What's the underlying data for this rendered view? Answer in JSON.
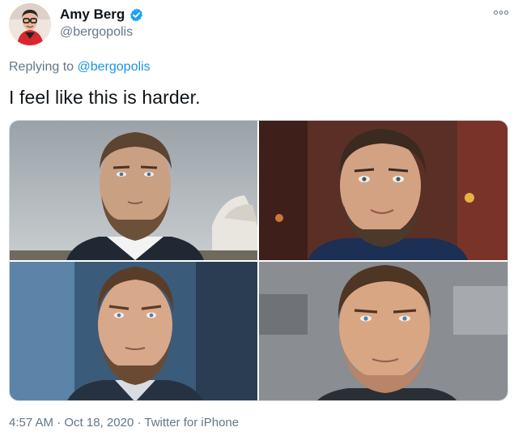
{
  "author": {
    "display_name": "Amy Berg",
    "handle": "@bergopolis",
    "verified": true
  },
  "reply": {
    "prefix": "Replying to",
    "to_handle": "@bergopolis"
  },
  "tweet": {
    "text": "I feel like this is harder."
  },
  "media": {
    "count": 4
  },
  "footer": {
    "time": "4:57 AM",
    "separator": "·",
    "date": "Oct 18, 2020",
    "source": "Twitter for iPhone"
  },
  "colors": {
    "text": "#0f1419",
    "secondary": "#657786",
    "link": "#1b95e0",
    "verified": "#1da1f2"
  },
  "icons": {
    "verified": "verified-badge-icon",
    "more": "more-options-icon"
  }
}
